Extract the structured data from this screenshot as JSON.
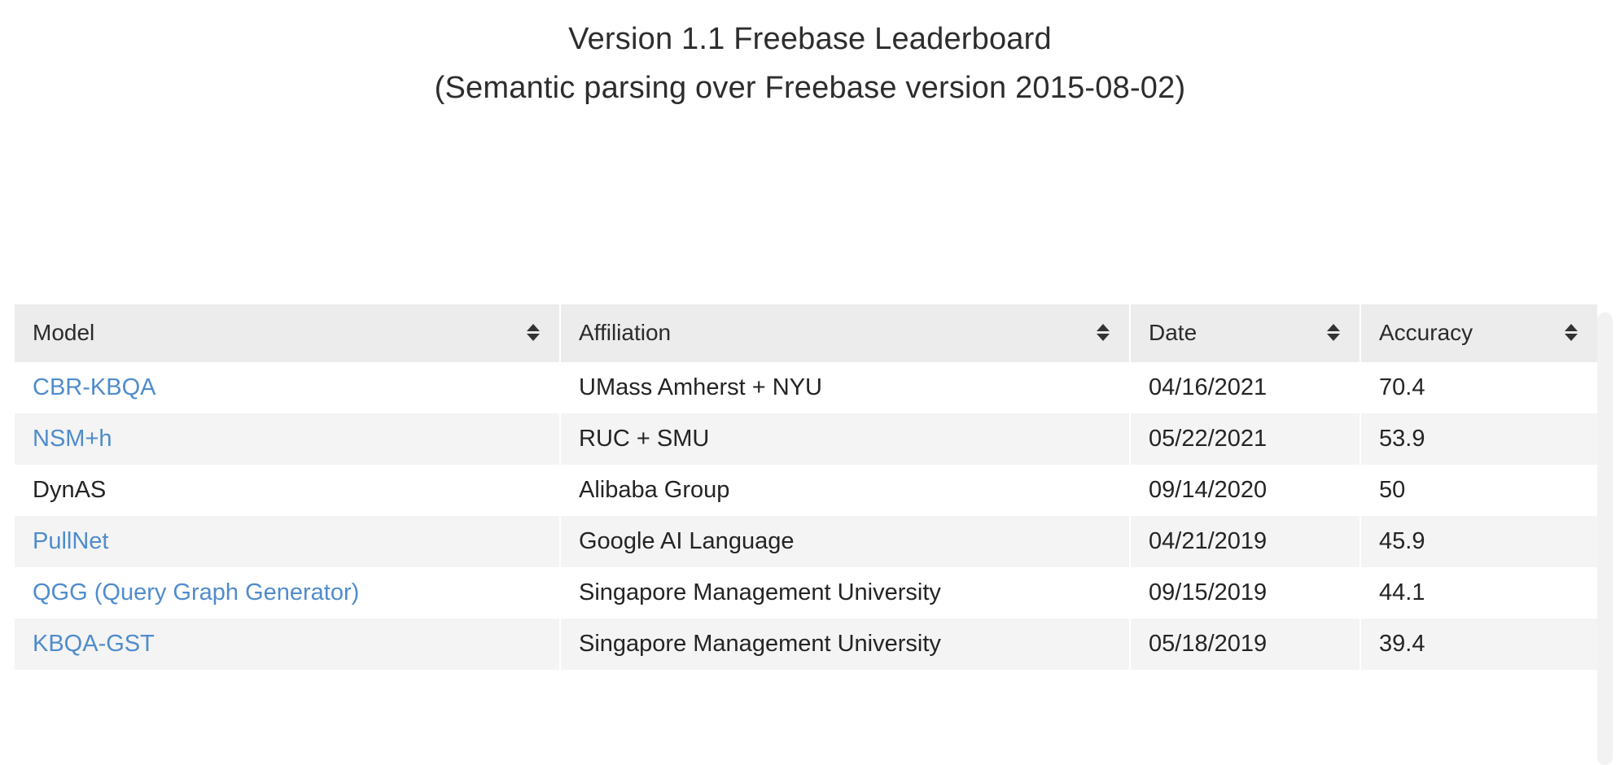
{
  "header": {
    "title_line1": "Version 1.1 Freebase Leaderboard",
    "title_line2": "(Semantic parsing over Freebase version 2015-08-02)"
  },
  "table": {
    "columns": [
      {
        "key": "model",
        "label": "Model",
        "sortable": true,
        "sort_icon": "sort-updown-icon"
      },
      {
        "key": "affil",
        "label": "Affiliation",
        "sortable": true,
        "sort_icon": "sort-updown-icon"
      },
      {
        "key": "date",
        "label": "Date",
        "sortable": true,
        "sort_icon": "sort-updown-icon"
      },
      {
        "key": "accuracy",
        "label": "Accuracy",
        "sortable": true,
        "sort_icon": "sort-updown-icon"
      }
    ],
    "rows": [
      {
        "model": "CBR-KBQA",
        "model_is_link": true,
        "affiliation": "UMass Amherst + NYU",
        "date": "04/16/2021",
        "accuracy": "70.4",
        "striped": false
      },
      {
        "model": "NSM+h",
        "model_is_link": true,
        "affiliation": "RUC + SMU",
        "date": "05/22/2021",
        "accuracy": "53.9",
        "striped": true
      },
      {
        "model": "DynAS",
        "model_is_link": false,
        "affiliation": "Alibaba Group",
        "date": "09/14/2020",
        "accuracy": "50",
        "striped": false
      },
      {
        "model": "PullNet",
        "model_is_link": true,
        "affiliation": "Google AI Language",
        "date": "04/21/2019",
        "accuracy": "45.9",
        "striped": true
      },
      {
        "model": "QGG (Query Graph Generator)",
        "model_is_link": true,
        "affiliation": "Singapore Management University",
        "date": "09/15/2019",
        "accuracy": "44.1",
        "striped": false
      },
      {
        "model": "KBQA-GST",
        "model_is_link": true,
        "affiliation": "Singapore Management University",
        "date": "05/18/2019",
        "accuracy": "39.4",
        "striped": true
      }
    ]
  },
  "colors": {
    "link": "#4f8ccc",
    "header_bg": "#ececec",
    "stripe_bg": "#f4f4f4",
    "text": "#242424",
    "scrollbar": "#f2f2f2"
  }
}
